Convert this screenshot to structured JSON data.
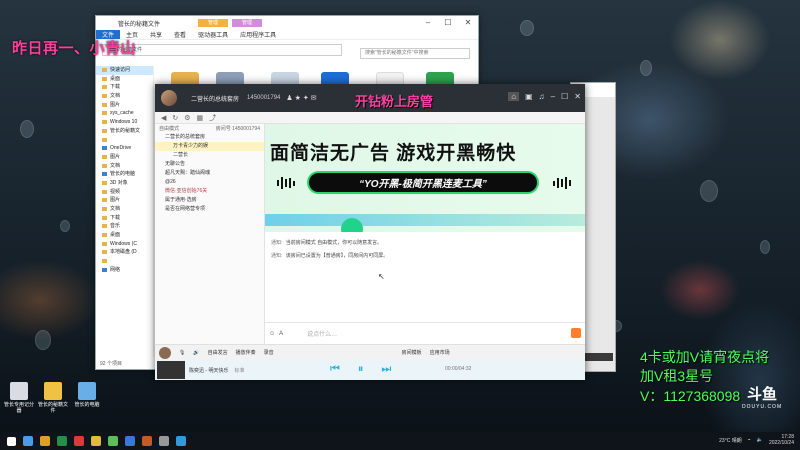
{
  "overlay": {
    "stream_title": "昨日再一、小青山",
    "promo_lines": [
      "4卡或加V请宵夜点将",
      "加V租3星号",
      "V：1127368098"
    ]
  },
  "desktop_icons": [
    {
      "label": "管长专用记分器"
    },
    {
      "label": "管长的秘籍文件"
    },
    {
      "label": "管长的电脑"
    }
  ],
  "explorer": {
    "ribbon_tabs": [
      "文件",
      "主页",
      "共享",
      "查看"
    ],
    "ribbon_context": [
      "管理",
      "管理"
    ],
    "ribbon_context_tabs": [
      "驱动器工具",
      "应用程序工具"
    ],
    "window_title": "管长的秘籍文件",
    "address": "管长的秘籍文件",
    "search_placeholder": "搜索\"管长的秘籍文件\"中搜索",
    "nav_items": [
      {
        "label": "快速访问",
        "sel": true
      },
      {
        "label": "桌面"
      },
      {
        "label": "下载"
      },
      {
        "label": "文档"
      },
      {
        "label": "图片"
      },
      {
        "label": "sys_cache"
      },
      {
        "label": "Windows 10"
      },
      {
        "label": "管长的秘籍文"
      },
      {
        "label": ""
      },
      {
        "label": "OneDrive",
        "blue": true
      },
      {
        "label": "图片"
      },
      {
        "label": "文档"
      },
      {
        "label": "管长的电脑",
        "blue": true
      },
      {
        "label": "3D 对象"
      },
      {
        "label": "视频"
      },
      {
        "label": "图片"
      },
      {
        "label": "文档"
      },
      {
        "label": "下载"
      },
      {
        "label": "音乐"
      },
      {
        "label": "桌面"
      },
      {
        "label": "Windows (C"
      },
      {
        "label": "本地磁盘 (D"
      },
      {
        "label": ""
      },
      {
        "label": "网络",
        "blue": true
      }
    ],
    "status": "92 个项目"
  },
  "yy": {
    "channel_title": "二营长的总统套房",
    "channel_id": "1450001794",
    "banner": "开钻粉上房管",
    "pane_head_left": "自由模式",
    "pane_head_right": "房间号 1450001794",
    "tree": [
      {
        "label": "二营长的总统套房",
        "kind": "root"
      },
      {
        "label": "万卡青少力的娱",
        "kind": "sub hl"
      },
      {
        "label": "二营长",
        "kind": "sub"
      },
      {
        "label": "无聊公告",
        "kind": "root"
      },
      {
        "label": "超凡天赐：踏仙阁魂",
        "kind": "root"
      },
      {
        "label": "@26",
        "kind": "root"
      },
      {
        "label": "微信·亚信创始76关",
        "kind": "root pink"
      },
      {
        "label": "属于通用·选房",
        "kind": "root"
      },
      {
        "label": "是否在网络营专项",
        "kind": "root"
      }
    ],
    "ad_big": "面简洁无广告  游戏开黑畅快",
    "ad_pill": "“YO开黑-极简开黑连麦工具”",
    "notices": [
      {
        "tag": "通知:",
        "text": "当前房间模式 自由模式，你可以随意发言。"
      },
      {
        "tag": "通知:",
        "text": "该房间已设置为【普通房】，同房间内可同屏。"
      }
    ],
    "input_placeholder": "说点什么…",
    "bottombar": [
      "自由发言",
      "播放伴奏",
      "录音",
      "房间模板",
      "应用市场"
    ],
    "player_title": "陈奕迅 - 明天快乐",
    "player_tag": "标准",
    "player_time": "00:00/04:32"
  },
  "taskbar": {
    "weather": "23°C 晴朗",
    "time": "17:28",
    "date": "2022/10/24"
  },
  "douyu": {
    "logo": "斗鱼",
    "sub": "DOUYU.COM"
  }
}
